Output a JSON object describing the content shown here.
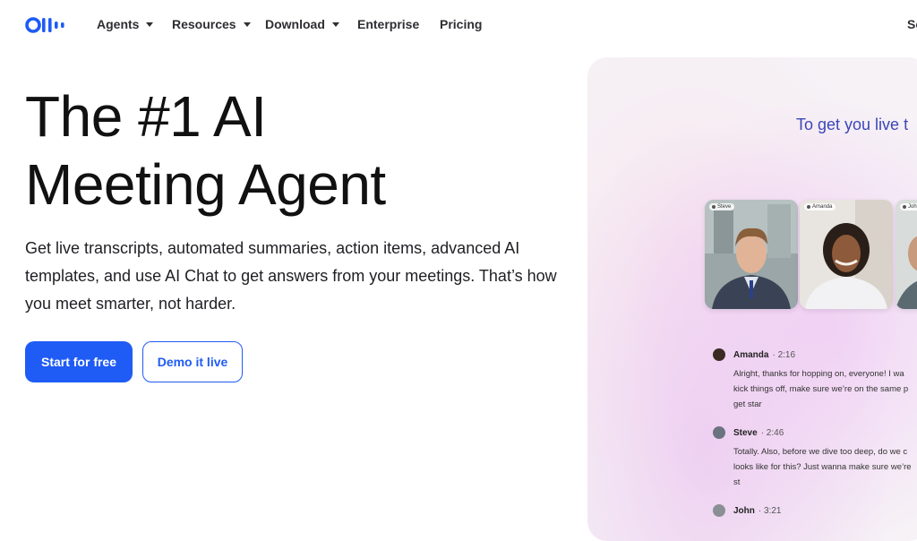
{
  "nav": {
    "items": [
      {
        "label": "Agents",
        "dropdown": true
      },
      {
        "label": "Resources",
        "dropdown": true
      },
      {
        "label": "Download",
        "dropdown": true
      },
      {
        "label": "Enterprise",
        "dropdown": false
      },
      {
        "label": "Pricing",
        "dropdown": false
      }
    ],
    "cut_item": "So"
  },
  "hero": {
    "title_line1": "The #1 AI",
    "title_line2": "Meeting Agent",
    "description": "Get live transcripts, automated summaries, action items, advanced AI templates, and use AI Chat to get answers from your meetings. That’s how you meet smarter, not harder.",
    "primary_button": "Start for free",
    "secondary_button": "Demo it live"
  },
  "demo": {
    "caption": "To get you live t",
    "participants": [
      "Steve",
      "Amanda",
      "John"
    ],
    "messages": [
      {
        "name": "Amanda",
        "time": "2:16",
        "lines": [
          "Alright, thanks for hopping on, everyone! I wa",
          "kick things off, make sure we’re on the same p",
          "get star"
        ]
      },
      {
        "name": "Steve",
        "time": "2:46",
        "lines": [
          "Totally. Also, before we dive too deep, do we c",
          "looks like for this? Just wanna make sure we’re",
          "st"
        ]
      },
      {
        "name": "John",
        "time": "3:21",
        "lines": []
      }
    ]
  },
  "colors": {
    "brand": "#1f5bf5",
    "caption": "#3c46b8"
  }
}
